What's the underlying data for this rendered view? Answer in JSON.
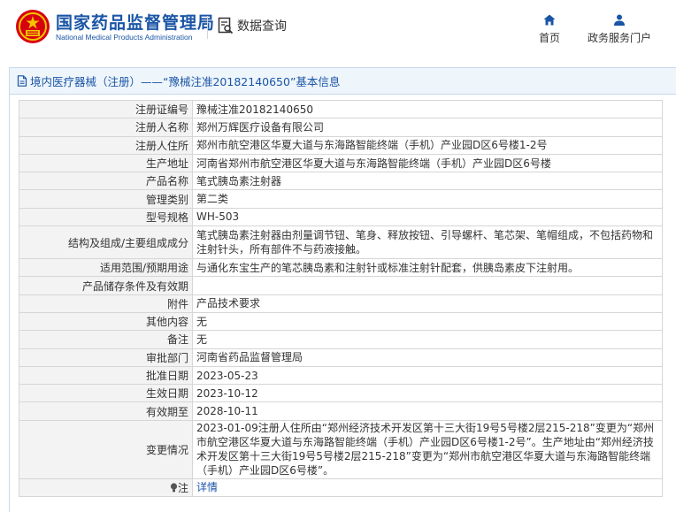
{
  "header": {
    "title_cn": "国家药品监督管理局",
    "title_en": "National Medical Products Administration",
    "query_label": "数据查询"
  },
  "nav": {
    "home": "首页",
    "portal": "政务服务门户"
  },
  "panel": {
    "heading": "境内医疗器械（注册）——“豫械注准20182140650”基本信息"
  },
  "rows": [
    {
      "label": "注册证编号",
      "value": "豫械注准20182140650"
    },
    {
      "label": "注册人名称",
      "value": "郑州万辉医疗设备有限公司"
    },
    {
      "label": "注册人住所",
      "value": "郑州市航空港区华夏大道与东海路智能终端（手机）产业园D区6号楼1-2号"
    },
    {
      "label": "生产地址",
      "value": "河南省郑州市航空港区华夏大道与东海路智能终端（手机）产业园D区6号楼"
    },
    {
      "label": "产品名称",
      "value": "笔式胰岛素注射器"
    },
    {
      "label": "管理类别",
      "value": "第二类"
    },
    {
      "label": "型号规格",
      "value": "WH-503"
    },
    {
      "label": "结构及组成/主要组成成分",
      "value": "笔式胰岛素注射器由剂量调节钮、笔身、释放按钮、引导螺杆、笔芯架、笔帽组成，不包括药物和注射针头，所有部件不与药液接触。"
    },
    {
      "label": "适用范围/预期用途",
      "value": "与通化东宝生产的笔芯胰岛素和注射针或标准注射针配套，供胰岛素皮下注射用。"
    },
    {
      "label": "产品储存条件及有效期",
      "value": ""
    },
    {
      "label": "附件",
      "value": "产品技术要求"
    },
    {
      "label": "其他内容",
      "value": "无"
    },
    {
      "label": "备注",
      "value": "无"
    },
    {
      "label": "审批部门",
      "value": "河南省药品监督管理局"
    },
    {
      "label": "批准日期",
      "value": "2023-05-23"
    },
    {
      "label": "生效日期",
      "value": "2023-10-12"
    },
    {
      "label": "有效期至",
      "value": "2028-10-11"
    },
    {
      "label": "变更情况",
      "value": "2023-01-09注册人住所由“郑州经济技术开发区第十三大街19号5号楼2层215-218”变更为“郑州市航空港区华夏大道与东海路智能终端（手机）产业园D区6号楼1-2号”。生产地址由“郑州经济技术开发区第十三大街19号5号楼2层215-218”变更为“郑州市航空港区华夏大道与东海路智能终端（手机）产业园D区6号楼”。"
    },
    {
      "label": "注",
      "value": "详情"
    }
  ],
  "colors": {
    "brand_blue": "#1a55a6",
    "emblem_red": "#d7000f",
    "emblem_gold": "#f2c500",
    "label_bg": "#f3f3f3",
    "panel_head_bg": "#eef5fb"
  },
  "icons": {
    "emblem": "national-emblem-icon",
    "query": "document-search-icon",
    "home": "home-icon",
    "portal": "user-icon",
    "heading": "document-icon",
    "note": "lightbulb-icon"
  }
}
